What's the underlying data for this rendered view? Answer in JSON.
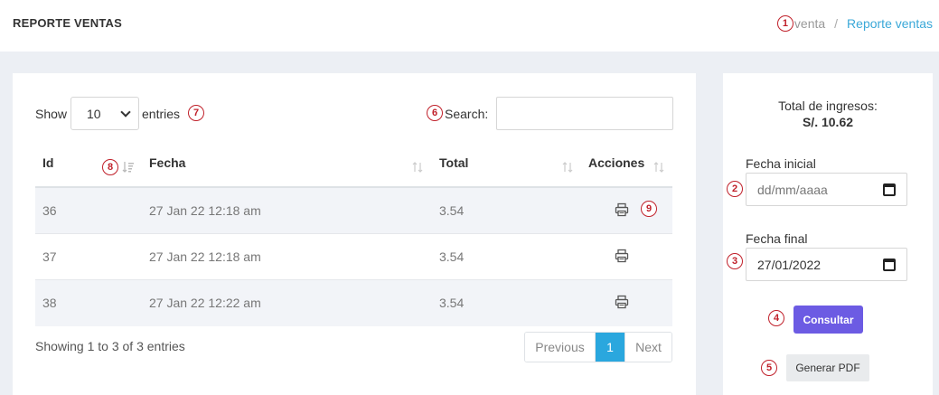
{
  "header": {
    "title": "REPORTE VENTAS",
    "breadcrumb": [
      "venta",
      "Reporte ventas"
    ],
    "separator": "/"
  },
  "table_controls": {
    "show_label": "Show",
    "page_size": "10",
    "entries_label": "entries",
    "search_label": "Search:",
    "search_value": ""
  },
  "table": {
    "columns": [
      "Id",
      "Fecha",
      "Total",
      "Acciones"
    ],
    "rows": [
      {
        "id": "36",
        "fecha": "27 Jan 22 12:18 am",
        "total": "3.54",
        "action_icon": "print-icon"
      },
      {
        "id": "37",
        "fecha": "27 Jan 22 12:18 am",
        "total": "3.54",
        "action_icon": "print-icon"
      },
      {
        "id": "38",
        "fecha": "27 Jan 22 12:22 am",
        "total": "3.54",
        "action_icon": "print-icon"
      }
    ]
  },
  "footer": {
    "info": "Showing 1 to 3 of 3 entries",
    "pagination": {
      "previous": "Previous",
      "current": "1",
      "next": "Next"
    }
  },
  "side": {
    "total_label": "Total de ingresos:",
    "total_value": "S/. 10.62",
    "start_label": "Fecha inicial",
    "start_placeholder": "dd/mm/aaaa",
    "end_label": "Fecha final",
    "end_value": "27/01/2022",
    "consult_button": "Consultar",
    "pdf_button": "Generar PDF"
  },
  "markers": [
    "1",
    "2",
    "3",
    "4",
    "5",
    "6",
    "7",
    "8",
    "9"
  ],
  "colors": {
    "primary_button": "#6c5be3",
    "active_page": "#2aa7de",
    "breadcrumb_link": "#3aa8d8",
    "marker": "#c0202a"
  }
}
